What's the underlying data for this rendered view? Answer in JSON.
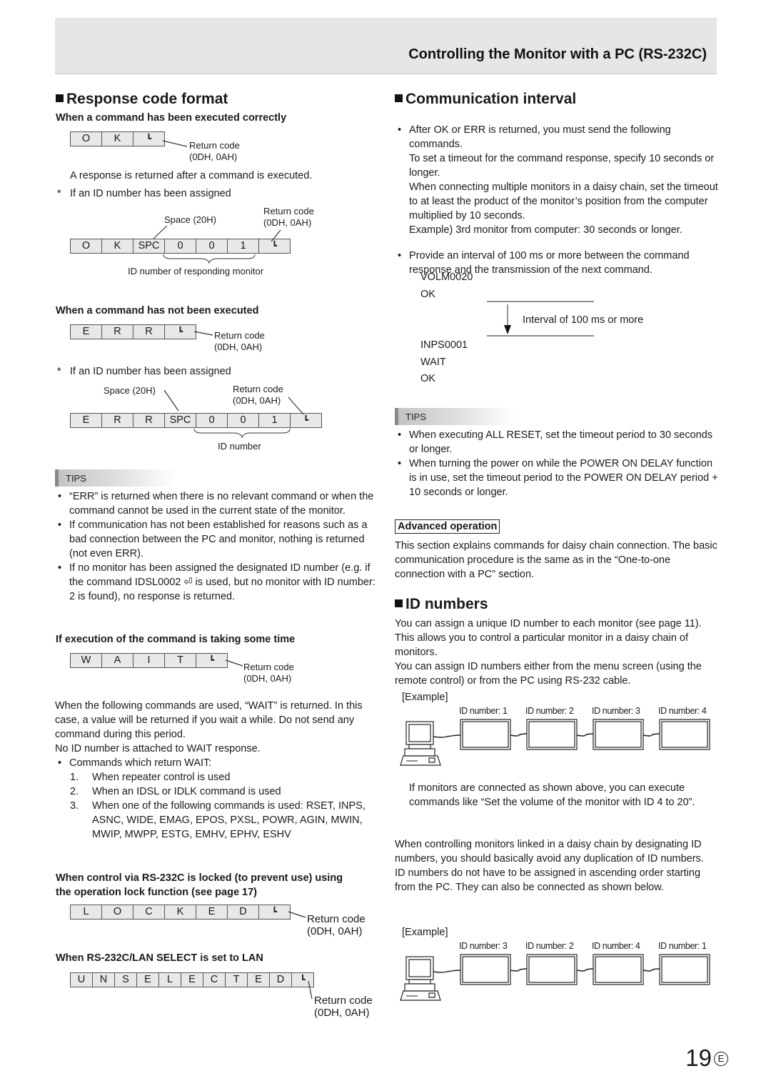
{
  "header": {
    "title": "Controlling the Monitor with a PC (RS-232C)"
  },
  "left": {
    "heading": "Response code format",
    "ok_section": {
      "title": "When a command has been executed correctly",
      "cells": [
        "O",
        "K",
        "↵"
      ],
      "return_label": "Return code",
      "return_hex": "(0DH, 0AH)",
      "desc": "A response is returned after a command is executed.",
      "id_note": "If an ID number has been assigned",
      "id_cells": [
        "O",
        "K",
        "SPC",
        "0",
        "0",
        "1",
        "↵"
      ],
      "space_label": "Space (20H)",
      "id_caption": "ID number of responding monitor"
    },
    "err_section": {
      "title": "When a command has not been executed",
      "cells": [
        "E",
        "R",
        "R",
        "↵"
      ],
      "id_note": "If an ID number has been assigned",
      "id_cells": [
        "E",
        "R",
        "R",
        "SPC",
        "0",
        "0",
        "1",
        "↵"
      ],
      "space_label": "Space (20H)",
      "id_caption": "ID number"
    },
    "tips": {
      "label": "TIPS",
      "items": [
        "“ERR” is returned when there is no relevant command or when the command cannot be used in the current state of the monitor.",
        "If communication has not been established for reasons such as a bad connection between the PC and monitor, nothing is returned (not even ERR).",
        "If no monitor has been assigned the designated ID number (e.g. if the command IDSL0002 ⏎ is used, but no monitor with ID number: 2 is found), no response is returned."
      ]
    },
    "wait_section": {
      "title": "If execution of the command is taking some time",
      "cells": [
        "W",
        "A",
        "I",
        "T",
        "↵"
      ],
      "paragraphs": [
        "When the following commands are used, “WAIT” is returned. In this case, a value will be returned if you wait a while. Do not send any command during this period.",
        "No ID number is attached to WAIT response."
      ],
      "bullet": "Commands which return WAIT:",
      "numbered": [
        {
          "n": "1.",
          "text": "When repeater control is used"
        },
        {
          "n": "2.",
          "text": "When an IDSL or IDLK command is used"
        },
        {
          "n": "3.",
          "text": "When one of the following commands is used: RSET, INPS, ASNC, WIDE, EMAG, EPOS, PXSL, POWR, AGIN, MWIN, MWIP, MWPP, ESTG, EMHV, EPHV, ESHV"
        }
      ]
    },
    "locked_section": {
      "title": "When control via RS-232C is locked (to prevent use) using the operation lock function (see page 17)",
      "cells": [
        "L",
        "O",
        "C",
        "K",
        "E",
        "D",
        "↵"
      ]
    },
    "lan_section": {
      "title": "When RS-232C/LAN SELECT is set to LAN",
      "cells": [
        "U",
        "N",
        "S",
        "E",
        "L",
        "E",
        "C",
        "T",
        "E",
        "D",
        "↵"
      ]
    },
    "return_label": "Return code",
    "return_hex": "(0DH, 0AH)"
  },
  "right": {
    "heading": "Communication interval",
    "bullets": [
      "After OK or ERR is returned, you must send the following commands.\nTo set a timeout for the command response, specify 10 seconds or longer.\nWhen connecting multiple monitors in a daisy chain, set the timeout to at least the product of the monitor’s position from the computer multiplied by 10 seconds.\nExample) 3rd monitor from computer: 30 seconds or longer.",
      "Provide an interval of 100 ms or more between the command response and the transmission of the next command."
    ],
    "sequence": [
      "VOLM0020",
      "OK",
      "INPS0001",
      "WAIT",
      "OK"
    ],
    "interval_label": "Interval of 100 ms or more",
    "tips": {
      "label": "TIPS",
      "items": [
        "When executing ALL RESET, set the timeout period to 30 seconds or longer.",
        "When turning the power on while the POWER ON DELAY function is in use, set the timeout period to the POWER ON DELAY period + 10 seconds or longer."
      ]
    },
    "advanced": {
      "label": "Advanced operation",
      "text": "This section explains commands for daisy chain connection. The basic communication procedure is the same as in the “One-to-one connection with a PC” section."
    },
    "id_numbers": {
      "heading": "ID numbers",
      "paragraphs": [
        "You can assign a unique ID number to each monitor (see page 11). This allows you to control a particular monitor in a daisy chain of monitors.",
        "You can assign ID numbers either from the menu screen (using the remote control) or from the PC using RS-232 cable."
      ],
      "example_label": "[Example]",
      "example1_ids": [
        "ID number: 1",
        "ID number: 2",
        "ID number: 3",
        "ID number: 4"
      ],
      "example1_note": "If monitors are connected as shown above, you can execute commands like “Set the volume of the monitor with ID 4 to 20”.",
      "paragraphs2": [
        "When controlling monitors linked in a daisy chain by designating ID numbers, you should basically avoid any duplication of ID numbers.",
        "ID numbers do not have to be assigned in ascending order starting from the PC. They can also be connected as shown below."
      ],
      "example2_ids": [
        "ID number: 3",
        "ID number: 2",
        "ID number: 4",
        "ID number: 1"
      ]
    }
  },
  "footer": {
    "page_number": "19",
    "lang_mark": "E"
  }
}
